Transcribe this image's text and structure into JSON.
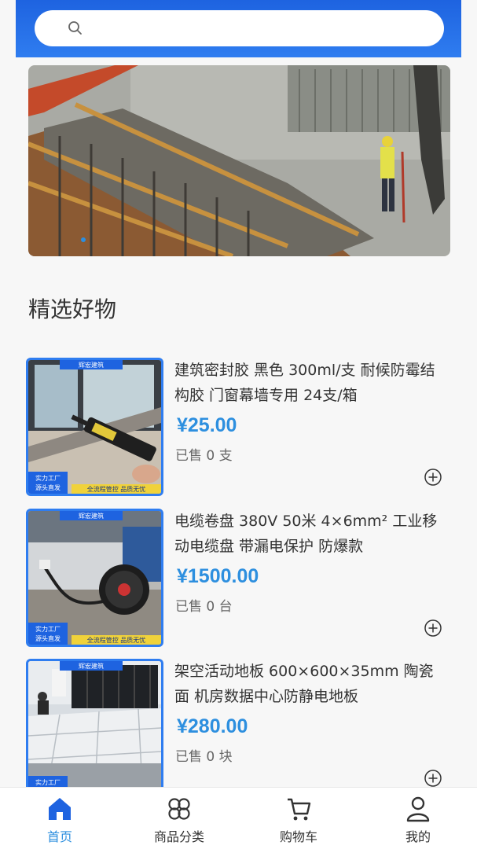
{
  "search": {
    "placeholder": "",
    "value": ""
  },
  "section": {
    "title": "精选好物"
  },
  "thumb_text": {
    "brand": "辉宏建筑",
    "tag_factory": "实力工厂",
    "tag_direct": "源头直发",
    "tag_control": "全流程管控",
    "tag_quality": "品质无忧"
  },
  "products": [
    {
      "name": "建筑密封胶 黑色 300ml/支 耐候防霉结构胶 门窗幕墙专用 24支/箱",
      "price": "¥25.00",
      "sold": "已售 0 支"
    },
    {
      "name": "电缆卷盘 380V 50米 4×6mm² 工业移动电缆盘 带漏电保护 防爆款",
      "price": "¥1500.00",
      "sold": "已售 0 台"
    },
    {
      "name": "架空活动地板 600×600×35mm 陶瓷面 机房数据中心防静电地板",
      "price": "¥280.00",
      "sold": "已售 0 块"
    }
  ],
  "tabbar": {
    "items": [
      {
        "label": "首页",
        "icon": "home-icon"
      },
      {
        "label": "商品分类",
        "icon": "category-icon"
      },
      {
        "label": "购物车",
        "icon": "cart-icon"
      },
      {
        "label": "我的",
        "icon": "user-icon"
      }
    ]
  },
  "colors": {
    "accent": "#2d8fdf",
    "header": "#2f7df0"
  }
}
